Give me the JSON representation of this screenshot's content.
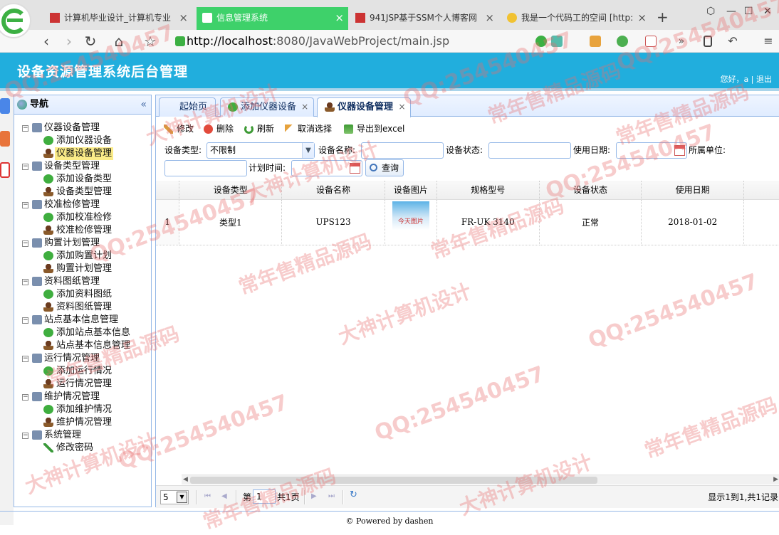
{
  "browser": {
    "tabs": [
      {
        "title": "计算机毕业设计_计算机专业",
        "close": "×"
      },
      {
        "title": "信息管理系统",
        "close": "×"
      },
      {
        "title": "941JSP基于SSM个人博客网",
        "close": "×"
      },
      {
        "title": "我是一个代码工的空间 [http:",
        "close": "×"
      }
    ],
    "new_tab": "+",
    "url_host": "http://localhost",
    "url_rest": ":8080/JavaWebProject/main.jsp",
    "colors": {
      "active_tab": "#3ed16a"
    }
  },
  "app": {
    "title": "设备资源管理系统后台管理",
    "user_text": "您好，a | 退出",
    "header_color": "#21aedd"
  },
  "sidebar": {
    "title": "导航",
    "collapse": "«",
    "groups": [
      {
        "label": "仪器设备管理",
        "items": [
          {
            "label": "添加仪器设备",
            "icon": "add-icon"
          },
          {
            "label": "仪器设备管理",
            "icon": "user-icon",
            "selected": true
          }
        ]
      },
      {
        "label": "设备类型管理",
        "items": [
          {
            "label": "添加设备类型",
            "icon": "add-icon"
          },
          {
            "label": "设备类型管理",
            "icon": "user-icon"
          }
        ]
      },
      {
        "label": "校准检修管理",
        "items": [
          {
            "label": "添加校准检修",
            "icon": "add-icon"
          },
          {
            "label": "校准检修管理",
            "icon": "user-icon"
          }
        ]
      },
      {
        "label": "购置计划管理",
        "items": [
          {
            "label": "添加购置计划",
            "icon": "add-icon"
          },
          {
            "label": "购置计划管理",
            "icon": "user-icon"
          }
        ]
      },
      {
        "label": "资料图纸管理",
        "items": [
          {
            "label": "添加资料图纸",
            "icon": "add-icon"
          },
          {
            "label": "资料图纸管理",
            "icon": "user-icon"
          }
        ]
      },
      {
        "label": "站点基本信息管理",
        "items": [
          {
            "label": "添加站点基本信息",
            "icon": "add-icon"
          },
          {
            "label": "站点基本信息管理",
            "icon": "user-icon"
          }
        ]
      },
      {
        "label": "运行情况管理",
        "items": [
          {
            "label": "添加运行情况",
            "icon": "add-icon"
          },
          {
            "label": "运行情况管理",
            "icon": "user-icon"
          }
        ]
      },
      {
        "label": "维护情况管理",
        "items": [
          {
            "label": "添加维护情况",
            "icon": "add-icon"
          },
          {
            "label": "维护情况管理",
            "icon": "user-icon"
          }
        ]
      },
      {
        "label": "系统管理",
        "items": [
          {
            "label": "修改密码",
            "icon": "pen-icon"
          }
        ]
      }
    ]
  },
  "tabs": [
    {
      "label": "起始页"
    },
    {
      "label": "添加仪器设备",
      "close": "×"
    },
    {
      "label": "仪器设备管理",
      "close": "×"
    }
  ],
  "toolbar": {
    "edit": "修改",
    "delete": "删除",
    "refresh": "刷新",
    "cancel_select": "取消选择",
    "export": "导出到excel"
  },
  "filter": {
    "type_label": "设备类型:",
    "type_value": "不限制",
    "name_label": "设备名称:",
    "status_label": "设备状态:",
    "usedate_label": "使用日期:",
    "unit_label": "所属单位:",
    "plantime_label": "计划时间:",
    "search": "查询"
  },
  "grid": {
    "columns": [
      "设备类型",
      "设备名称",
      "设备图片",
      "规格型号",
      "设备状态",
      "使用日期"
    ],
    "rows": [
      {
        "rownum": "1",
        "cells": [
          "类型1",
          "UPS123",
          "",
          "FR-UK 3140",
          "正常",
          "2018-01-02"
        ],
        "image_text": "今天图片"
      }
    ]
  },
  "pager": {
    "page_size": "5",
    "page_prefix": "第",
    "page_value": "1",
    "page_suffix": "共1页",
    "summary": "显示1到1,共1记录"
  },
  "footer": "© Powered by dashen",
  "watermarks": [
    "QQ:254540457",
    "常年售精品源码",
    "大神计算机设计"
  ]
}
